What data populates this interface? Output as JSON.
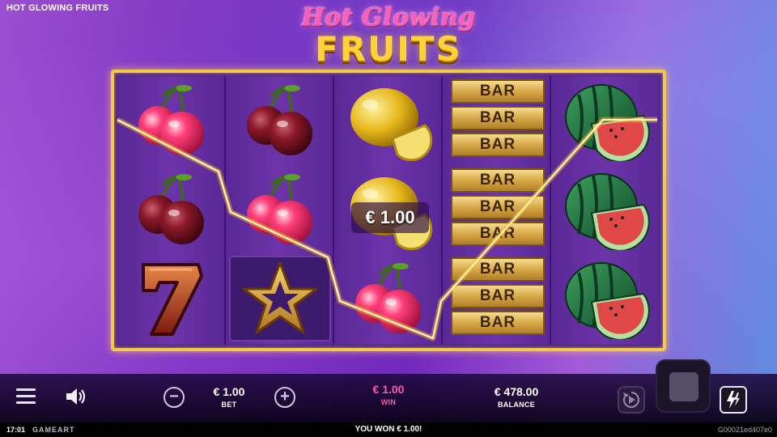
{
  "header": {
    "game_name": "HOT GLOWING FRUITS"
  },
  "logo": {
    "line1": "Hot Glowing",
    "line2": "FRUITS"
  },
  "reels": {
    "columns": [
      [
        "cherry",
        "cherry",
        "seven"
      ],
      [
        "cherry",
        "cherry",
        "star"
      ],
      [
        "lemon",
        "lemon",
        "cherry"
      ],
      [
        "triple-bar",
        "triple-bar",
        "triple-bar"
      ],
      [
        "watermelon",
        "watermelon",
        "watermelon"
      ]
    ],
    "bar_text": "BAR",
    "win_amount": "€ 1.00"
  },
  "controls": {
    "minus": "−",
    "plus": "+",
    "bet_value": "€ 1.00",
    "bet_label": "BET",
    "win_value": "€ 1.00",
    "win_label": "WIN",
    "balance_value": "€ 478.00",
    "balance_label": "BALANCE"
  },
  "footer": {
    "time": "17:01",
    "brand": "GAMEART",
    "message": "YOU WON € 1.00!",
    "session_id": "G00021ed407e0"
  },
  "colors": {
    "frame": "#f4c84a",
    "win_text": "#ff5aa8",
    "winline": "#ffe27a"
  }
}
